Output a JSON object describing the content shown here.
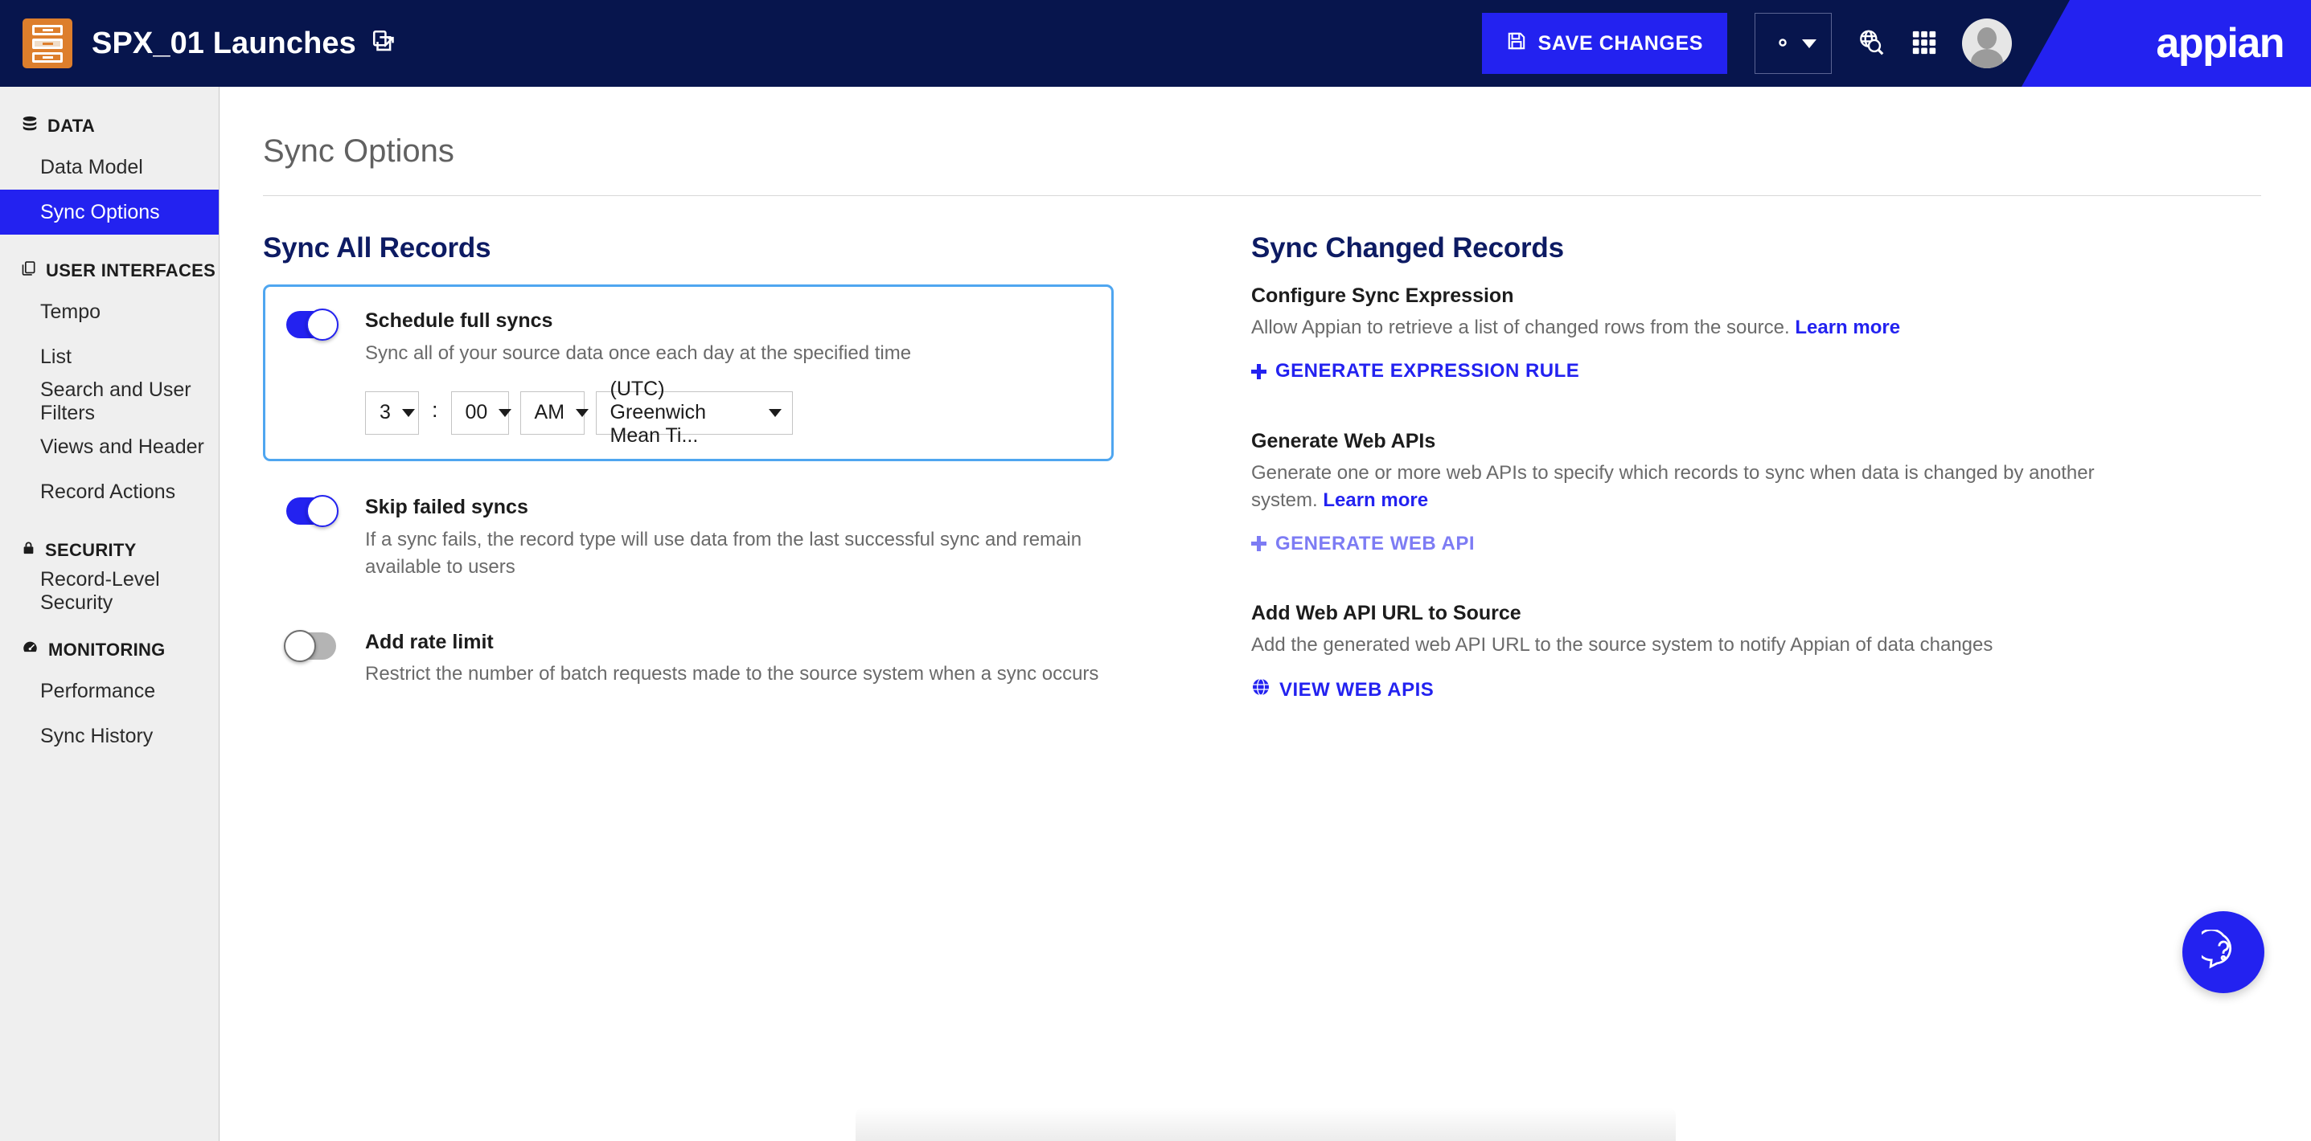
{
  "header": {
    "app_title": "SPX_01 Launches",
    "app_icon": "record-type-icon",
    "title_link_icon": "open-in-new-icon",
    "save_label": "SAVE CHANGES",
    "save_icon": "save-disk-icon",
    "gear_icon": "gear-icon",
    "globe_search_icon": "globe-search-icon",
    "grid_icon": "app-grid-icon",
    "avatar_icon": "user-avatar",
    "brand": "appian",
    "accent_blue": "#2322f0",
    "navy": "#07154d",
    "orange": "#dd7e2c"
  },
  "sidebar": {
    "groups": [
      {
        "label": "DATA",
        "icon": "database-icon",
        "items": [
          {
            "label": "Data Model",
            "active": false
          },
          {
            "label": "Sync Options",
            "active": true
          }
        ]
      },
      {
        "label": "USER INTERFACES",
        "icon": "copy-pages-icon",
        "items": [
          {
            "label": "Tempo",
            "active": false
          },
          {
            "label": "List",
            "active": false
          },
          {
            "label": "Search and User Filters",
            "active": false
          },
          {
            "label": "Views and Header",
            "active": false
          },
          {
            "label": "Record Actions",
            "active": false
          }
        ]
      },
      {
        "label": "SECURITY",
        "icon": "lock-icon",
        "items": [
          {
            "label": "Record-Level Security",
            "active": false
          }
        ]
      },
      {
        "label": "MONITORING",
        "icon": "gauge-icon",
        "items": [
          {
            "label": "Performance",
            "active": false
          },
          {
            "label": "Sync History",
            "active": false
          }
        ]
      }
    ]
  },
  "main": {
    "page_title": "Sync Options",
    "left": {
      "title": "Sync All Records",
      "options": [
        {
          "label": "Schedule full syncs",
          "description": "Sync all of your source data once each day at the specified time",
          "toggle_state": "on",
          "highlighted": true
        },
        {
          "label": "Skip failed syncs",
          "description": "If a sync fails, the record type will use data from the last successful sync and remain available to users",
          "toggle_state": "on",
          "highlighted": false
        },
        {
          "label": "Add rate limit",
          "description": "Restrict the number of batch requests made to the source system when a sync occurs",
          "toggle_state": "off",
          "highlighted": false
        }
      ],
      "time": {
        "hour": "3",
        "separator": ":",
        "minute": "00",
        "meridiem": "AM",
        "timezone": "(UTC) Greenwich Mean Ti..."
      }
    },
    "right": {
      "title": "Sync Changed Records",
      "blocks": [
        {
          "heading": "Configure Sync Expression",
          "description": "Allow Appian to retrieve a list of changed rows from the source.",
          "learn_more": "Learn more",
          "action_label": "GENERATE EXPRESSION RULE",
          "action_icon": "plus-icon",
          "action_muted": false
        },
        {
          "heading": "Generate Web APIs",
          "description": "Generate one or more web APIs to specify which records to sync when data is changed by another system.",
          "learn_more": "Learn more",
          "action_label": "GENERATE WEB API",
          "action_icon": "plus-icon",
          "action_muted": true
        },
        {
          "heading": "Add Web API URL to Source",
          "description": "Add the generated web API URL to the source system to notify Appian of data changes",
          "learn_more": "",
          "action_label": "VIEW WEB APIS",
          "action_icon": "globe-icon",
          "action_muted": false
        }
      ]
    },
    "help_button": {
      "icon": "question-chat-icon",
      "label": "?"
    }
  }
}
